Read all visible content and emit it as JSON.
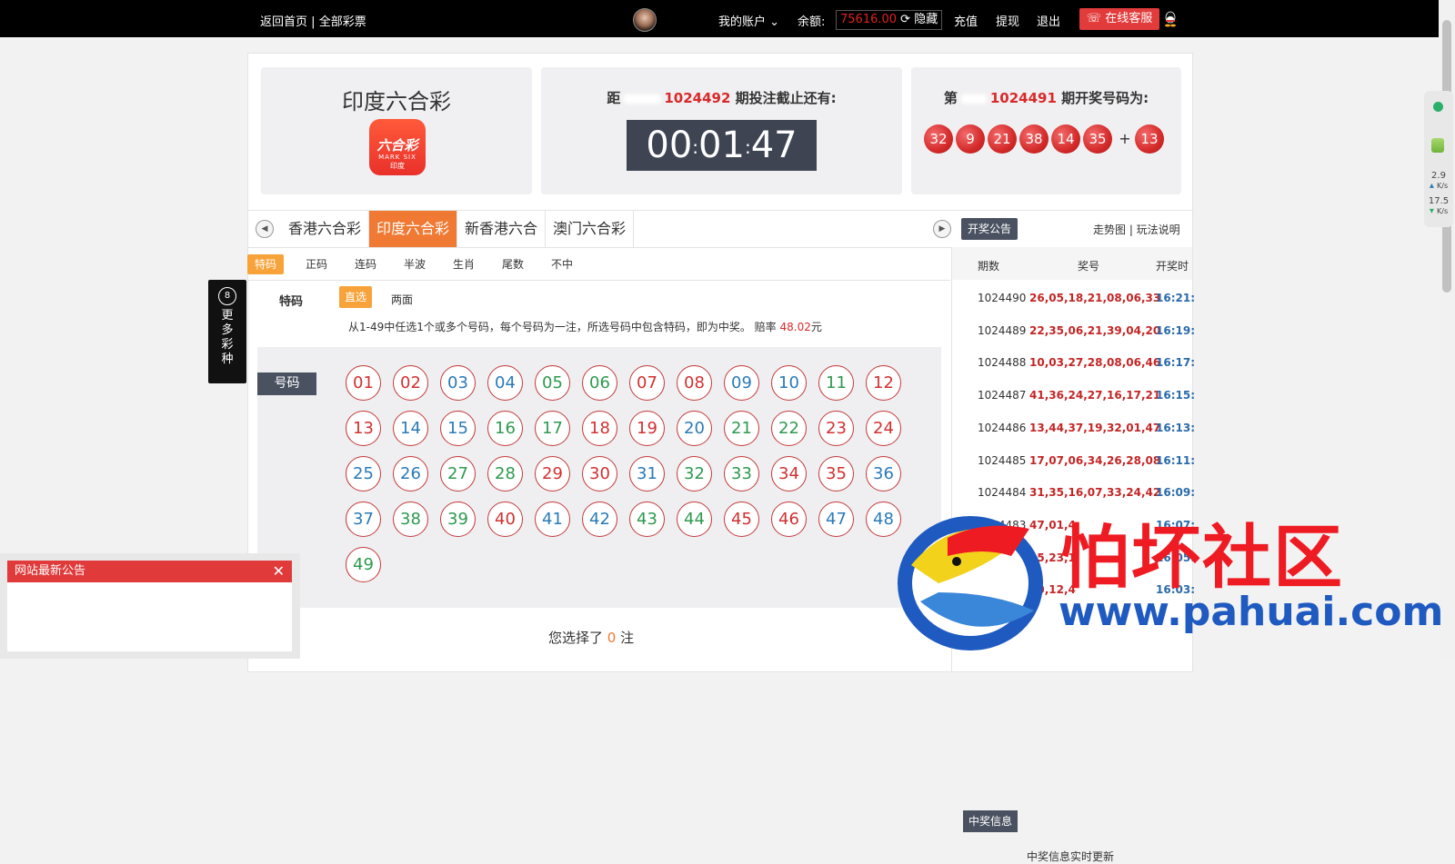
{
  "topbar": {
    "home": "返回首页",
    "sep": "|",
    "all_lotto": "全部彩票",
    "my_account": "我的账户",
    "balance_label": "余额:",
    "balance": "75616.00",
    "hide": "隐藏",
    "recharge": "充值",
    "withdraw": "提现",
    "logout": "退出",
    "service": "在线客服"
  },
  "speed": {
    "up": "2.9",
    "up_unit": "K/s",
    "down": "17.5",
    "down_unit": "K/s"
  },
  "lotto": {
    "name": "印度六合彩",
    "logo_main": "六合彩",
    "logo_mark": "MARK SIX",
    "logo_sub": "印度"
  },
  "countdown": {
    "prefix": "距",
    "issue": "1024492",
    "suffix": "期投注截止还有:",
    "hh": "00",
    "mm": "01",
    "ss": "47",
    "colon": ":"
  },
  "last_draw": {
    "prefix": "第",
    "issue": "1024491",
    "suffix": "期开奖号码为:",
    "balls": [
      "32",
      "9",
      "21",
      "38",
      "14",
      "35"
    ],
    "plus": "+",
    "special": "13"
  },
  "tabs": [
    "香港六合彩",
    "印度六合彩",
    "新香港六合",
    "澳门六合彩"
  ],
  "notice_btn": "开奖公告",
  "links": "走势图 | 玩法说明",
  "subtabs": [
    "特码",
    "正码",
    "连码",
    "半波",
    "生肖",
    "尾数",
    "不中"
  ],
  "play": {
    "label": "特码",
    "zhixuan": "直选",
    "liangmian": "两面",
    "desc": "从1-49中任选1个或多个号码，每个号码为一注，所选号码中包含特码，即为中奖。 赔率",
    "odds": "48.02",
    "odds_unit": "元",
    "haoma": "号码"
  },
  "numbers": [
    "01",
    "02",
    "03",
    "04",
    "05",
    "06",
    "07",
    "08",
    "09",
    "10",
    "11",
    "12",
    "13",
    "14",
    "15",
    "16",
    "17",
    "18",
    "19",
    "20",
    "21",
    "22",
    "23",
    "24",
    "25",
    "26",
    "27",
    "28",
    "29",
    "30",
    "31",
    "32",
    "33",
    "34",
    "35",
    "36",
    "37",
    "38",
    "39",
    "40",
    "41",
    "42",
    "43",
    "44",
    "45",
    "46",
    "47",
    "48",
    "49"
  ],
  "selected": {
    "prefix": "您选择了",
    "count": "0",
    "suffix": "注"
  },
  "history": {
    "headers": [
      "期数",
      "奖号",
      "开奖时"
    ],
    "rows": [
      {
        "issue": "1024490",
        "nums": "26,05,18,21,08,06,33",
        "time": "16:21:"
      },
      {
        "issue": "1024489",
        "nums": "22,35,06,21,39,04,20",
        "time": "16:19:"
      },
      {
        "issue": "1024488",
        "nums": "10,03,27,28,08,06,46",
        "time": "16:17:"
      },
      {
        "issue": "1024487",
        "nums": "41,36,24,27,16,17,21",
        "time": "16:15:"
      },
      {
        "issue": "1024486",
        "nums": "13,44,37,19,32,01,47",
        "time": "16:13:"
      },
      {
        "issue": "1024485",
        "nums": "17,07,06,34,26,28,08",
        "time": "16:11:"
      },
      {
        "issue": "1024484",
        "nums": "31,35,16,07,33,24,42",
        "time": "16:09:"
      },
      {
        "issue": "1024483",
        "nums": "47,01,4",
        "time": "16:07:"
      },
      {
        "issue": "1024482",
        "nums": "25,23,1",
        "time": "16:05:"
      },
      {
        "issue": "1024481",
        "nums": "20,12,4",
        "time": "16:03:"
      }
    ],
    "notice": "中奖信息",
    "tail": "中奖信息实时更新"
  },
  "side_more": {
    "icon": "8",
    "text": "更多彩种"
  },
  "announce": {
    "title": "网站最新公告",
    "close": "✕"
  },
  "watermark": {
    "cn": "怕坏社区",
    "url": "www.pahuai.com"
  }
}
